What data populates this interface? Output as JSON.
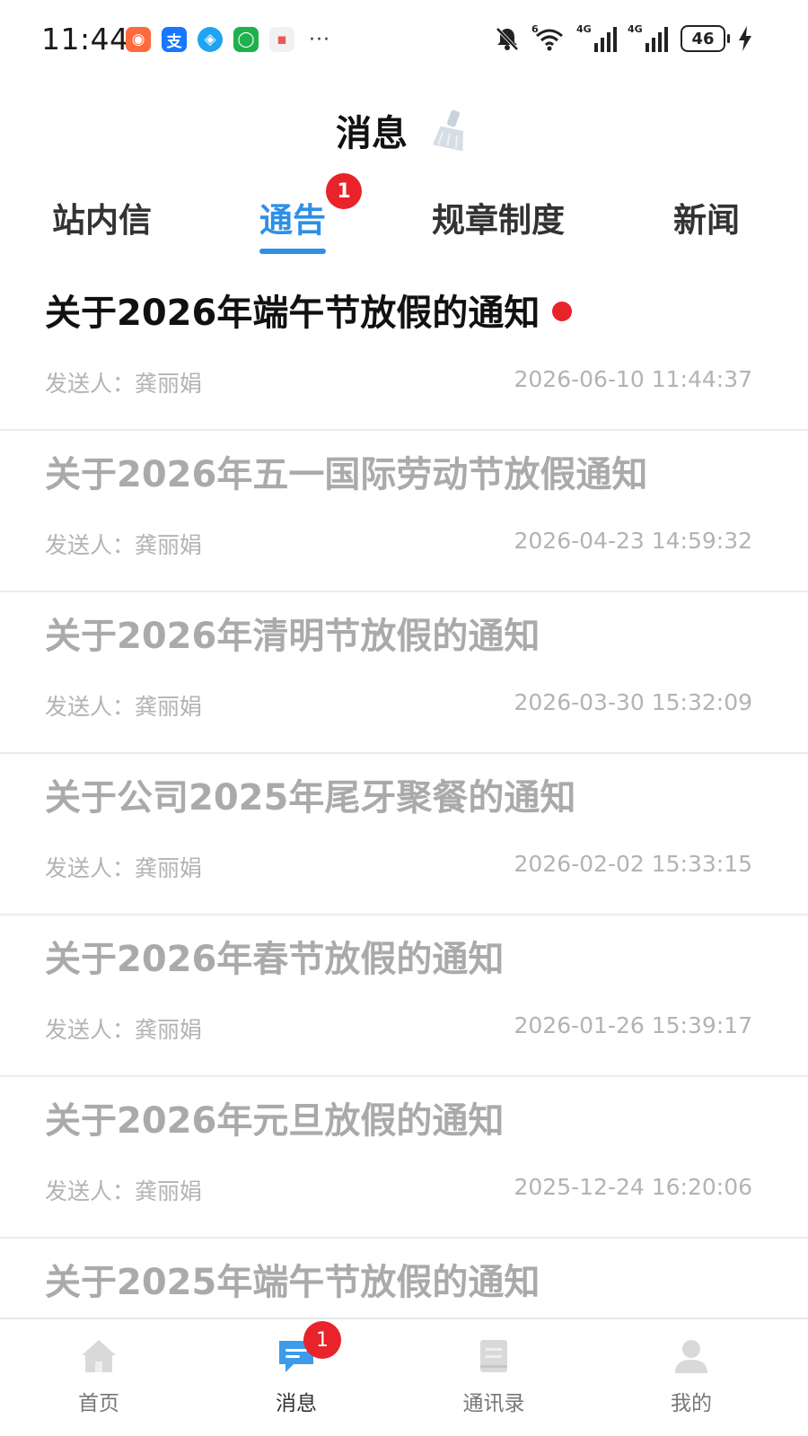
{
  "status_bar": {
    "time": "11:44",
    "apps": [
      {
        "icon": "app-mascot-icon",
        "color": "#ff6a3d",
        "glyph": "◉"
      },
      {
        "icon": "alipay-icon",
        "color": "#1677ff",
        "glyph": "支"
      },
      {
        "icon": "browser-icon",
        "color": "#20a4f0",
        "glyph": "◈"
      },
      {
        "icon": "chat-icon",
        "color": "#1fb14c",
        "glyph": "◯"
      },
      {
        "icon": "mail-app-icon",
        "color": "#e85a5a",
        "glyph": "▪"
      }
    ],
    "more": "···",
    "network_1": "4G",
    "network_2": "4G",
    "wifi_tag": "6",
    "battery": "46"
  },
  "header": {
    "title": "消息"
  },
  "tabs": [
    {
      "label": "站内信",
      "active": false
    },
    {
      "label": "通告",
      "active": true,
      "badge": "1"
    },
    {
      "label": "规章制度",
      "active": false
    },
    {
      "label": "新闻",
      "active": false
    }
  ],
  "notices": [
    {
      "title": "关于2026年端午节放假的通知",
      "sender": "发送人：龚丽娟",
      "time": "2026-06-10 11:44:37",
      "unread": true
    },
    {
      "title": "关于2026年五一国际劳动节放假通知",
      "sender": "发送人：龚丽娟",
      "time": "2026-04-23 14:59:32",
      "unread": false
    },
    {
      "title": "关于2026年清明节放假的通知",
      "sender": "发送人：龚丽娟",
      "time": "2026-03-30 15:32:09",
      "unread": false
    },
    {
      "title": "关于公司2025年尾牙聚餐的通知",
      "sender": "发送人：龚丽娟",
      "time": "2026-02-02 15:33:15",
      "unread": false
    },
    {
      "title": "关于2026年春节放假的通知",
      "sender": "发送人：龚丽娟",
      "time": "2026-01-26 15:39:17",
      "unread": false
    },
    {
      "title": "关于2026年元旦放假的通知",
      "sender": "发送人：龚丽娟",
      "time": "2025-12-24 16:20:06",
      "unread": false
    },
    {
      "title": "关于2025年端午节放假的通知",
      "sender": "",
      "time": "",
      "unread": false
    }
  ],
  "bottom_nav": [
    {
      "label": "首页",
      "icon": "home-icon",
      "active": false
    },
    {
      "label": "消息",
      "icon": "message-icon",
      "active": true,
      "badge": "1"
    },
    {
      "label": "通讯录",
      "icon": "contacts-icon",
      "active": false
    },
    {
      "label": "我的",
      "icon": "profile-icon",
      "active": false
    }
  ],
  "colors": {
    "accent": "#2f8fe6",
    "badge": "#e8232a",
    "muted_text": "#aaaaaa"
  }
}
